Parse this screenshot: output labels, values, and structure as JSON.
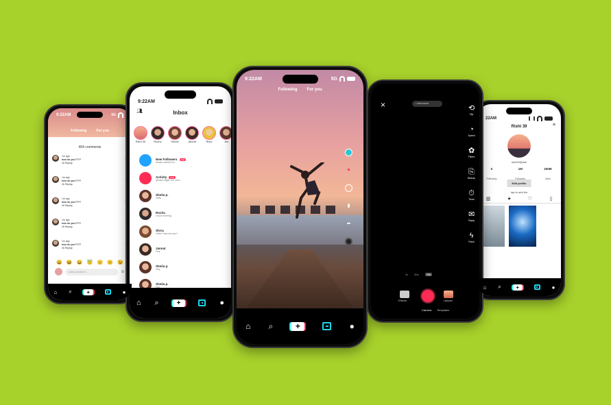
{
  "colors": {
    "background": "#a7d12b",
    "accent_red": "#fe2c55",
    "accent_cyan": "#20d5ec"
  },
  "nav": {
    "icons": [
      "home-icon",
      "search-icon",
      "plus-icon",
      "inbox-icon",
      "profile-icon"
    ]
  },
  "phone1": {
    "status_time": "9:22AM",
    "status_net": "5G",
    "tabs": [
      "Following",
      "For you"
    ],
    "comments_count": "404 comments",
    "comments": [
      {
        "time": "1m ago",
        "text": "how do you????",
        "meta": "4h  Replay"
      },
      {
        "time": "1m ago",
        "text": "how do you????",
        "meta": "4h  Replay"
      },
      {
        "time": "1m ago",
        "text": "how do you????",
        "meta": "4h  Replay"
      },
      {
        "time": "1m ago",
        "text": "how do you????",
        "meta": "4h  Replay"
      },
      {
        "time": "1m ago",
        "text": "how do you????",
        "meta": "4h  Replay"
      }
    ],
    "emojis": [
      "😀",
      "😆",
      "😄",
      "😇",
      "😑",
      "😐",
      "😉"
    ],
    "add_placeholder": "Add comment ..."
  },
  "phone2": {
    "status_time": "9:22AM",
    "title": "Inbox",
    "stories": [
      {
        "name": "Rishi 39"
      },
      {
        "name": "Ruchu"
      },
      {
        "name": "Shiree"
      },
      {
        "name": "Jannat"
      },
      {
        "name": "Rishi"
      },
      {
        "name": "Jim"
      }
    ],
    "items": [
      {
        "name": "New Followers",
        "sub": "Ahaan started fol...",
        "badge": "new"
      },
      {
        "name": "Activity",
        "sub": "@hash tagat 1h3 com...",
        "badge": "new"
      },
      {
        "name": "Sheila p.",
        "sub": "Hello",
        "badge": ""
      },
      {
        "name": "Rochu",
        "sub": "Good morning",
        "badge": ""
      },
      {
        "name": "Shrra",
        "sub": "Hello! How are you?",
        "badge": ""
      },
      {
        "name": "Jannat",
        "sub": "Hey",
        "badge": ""
      },
      {
        "name": "Sheila p.",
        "sub": "Hey",
        "badge": ""
      },
      {
        "name": "Sheila p.",
        "sub": "Hey",
        "badge": ""
      }
    ]
  },
  "phone3": {
    "status_time": "9:22AM",
    "status_net": "5G",
    "tabs": [
      "Following",
      "For you"
    ],
    "side_icons": [
      "avatar-icon",
      "heart-icon",
      "comment-icon",
      "bookmark-icon",
      "share-icon",
      "music-disc-icon"
    ]
  },
  "phone4": {
    "add_sound": "Add sound",
    "tools": [
      {
        "icon": "flip-icon",
        "label": "Flip"
      },
      {
        "icon": "speed-icon",
        "label": "Speed"
      },
      {
        "icon": "filters-icon",
        "label": "Filters"
      },
      {
        "icon": "beauty-icon",
        "label": "Beauty"
      },
      {
        "icon": "timer-icon",
        "label": "Timer"
      },
      {
        "icon": "reply-icon",
        "label": "Reply"
      },
      {
        "icon": "flash-icon",
        "label": "Flash"
      }
    ],
    "speeds": [
      "3x",
      "60s",
      "15s"
    ],
    "effects": "Effects",
    "camera": "Camera",
    "templates": "Templates",
    "upload": "Upload"
  },
  "phone5": {
    "status_time": "22AM",
    "name": "Rishi 39",
    "handle": "rishi39@dsk",
    "stats": [
      {
        "value": "0",
        "label": "Following"
      },
      {
        "value": "1M",
        "label": "Followers"
      },
      {
        "value": "200M",
        "label": "Likes"
      }
    ],
    "edit": "Edit profile",
    "bio": "tap to add bio"
  }
}
